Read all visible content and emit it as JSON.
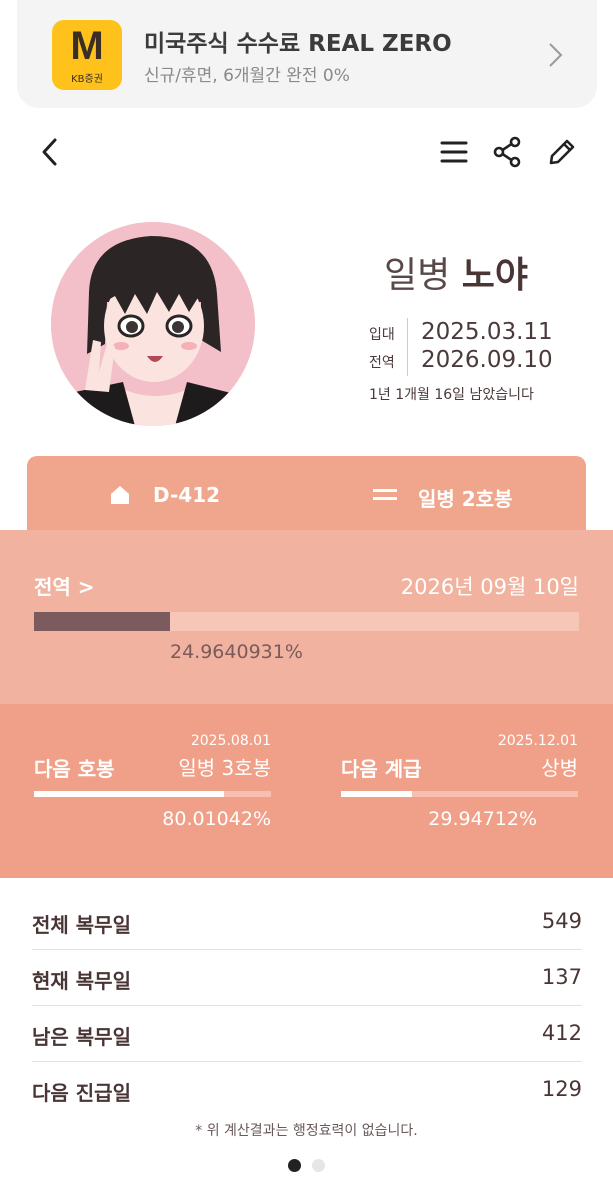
{
  "ad": {
    "logo_letter": "M",
    "logo_caption": "KB증권",
    "title": "미국주식 수수료 REAL ZERO",
    "subtitle": "신규/휴면, 6개월간 완전 0%",
    "logo_color": "#ffc21c"
  },
  "nav": {
    "back_icon": "chevron-left-icon",
    "menu_icon": "hamburger-icon",
    "share_icon": "share-icon",
    "edit_icon": "pencil-icon"
  },
  "profile": {
    "rank": "일병",
    "name": "노야",
    "enlist_label": "입대",
    "enlist_date": "2025.03.11",
    "discharge_label": "전역",
    "discharge_date": "2026.09.10",
    "remaining_text": "1년 1개월 16일 남았습니다"
  },
  "summary": {
    "home_icon": "home-icon",
    "dday": "D-412",
    "equals_icon": "equals-icon",
    "grade": "일병 2호봉"
  },
  "discharge": {
    "label": "전역 >",
    "date": "2026년 09월 10일",
    "percent_text": "24.9640931%",
    "percent": 24.9640931
  },
  "next_step": {
    "label": "다음 호봉",
    "date": "2025.08.01",
    "value": "일병 3호봉",
    "percent_text": "80.01042%",
    "percent": 80.01042
  },
  "next_rank": {
    "label": "다음 계급",
    "date": "2025.12.01",
    "value": "상병",
    "percent_text": "29.94712%",
    "percent": 29.94712
  },
  "stats": [
    {
      "label": "전체 복무일",
      "value": "549"
    },
    {
      "label": "현재 복무일",
      "value": "137"
    },
    {
      "label": "남은 복무일",
      "value": "412"
    },
    {
      "label": "다음 진급일",
      "value": "129"
    }
  ],
  "note": "* 위 계산결과는 행정효력이 없습니다.",
  "colors": {
    "accent": "#f0a68c",
    "section_light": "#f1b39f",
    "section_dark": "#f0a088",
    "progress_fill": "#7c5b5f"
  },
  "pager": {
    "active_index": 0,
    "count": 2
  }
}
